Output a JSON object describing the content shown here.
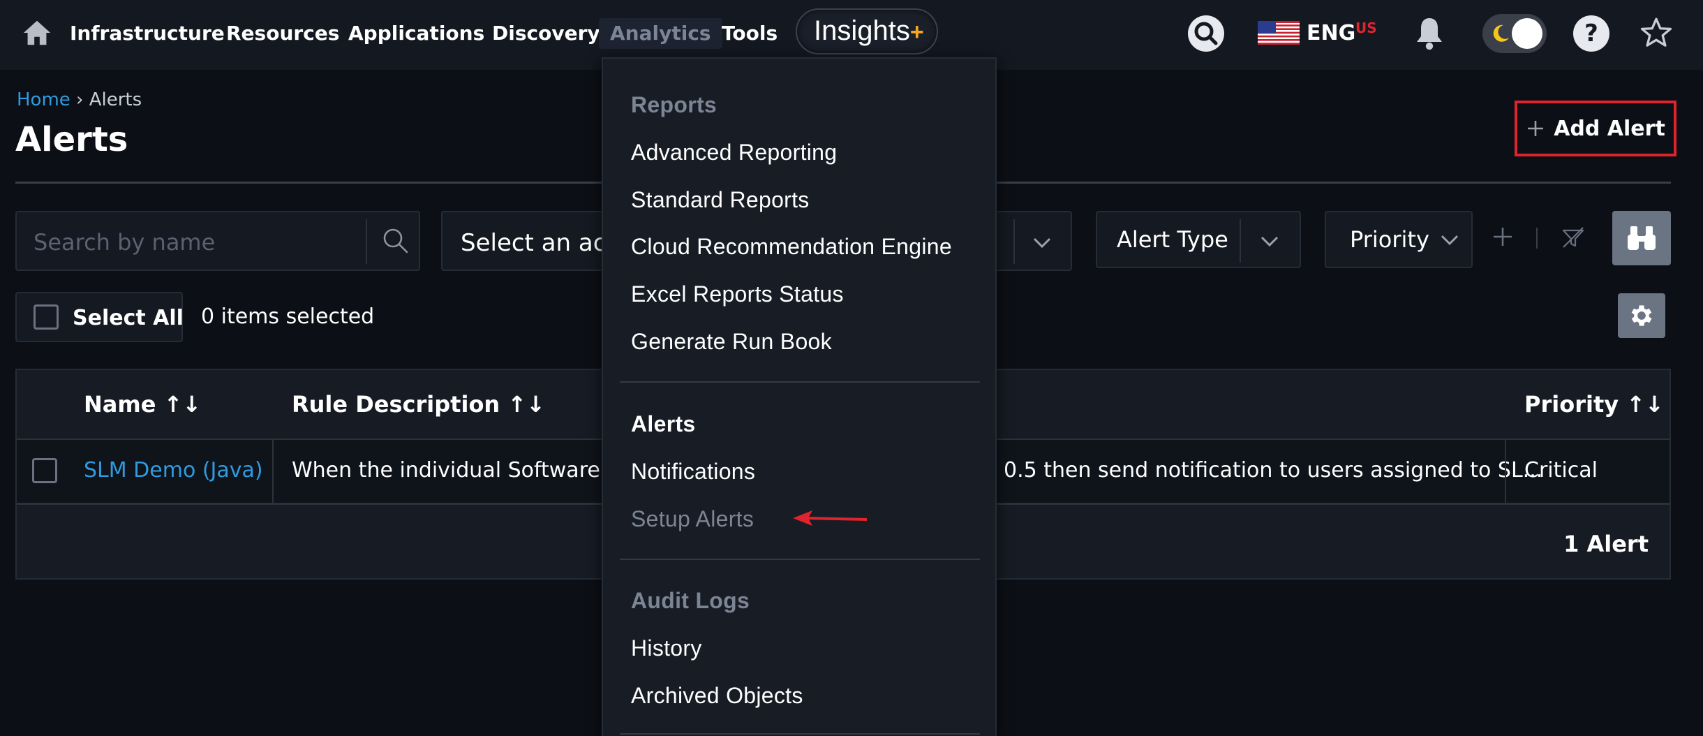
{
  "nav": {
    "items": [
      "Infrastructure",
      "Resources",
      "Applications",
      "Discovery",
      "Analytics",
      "Tools"
    ],
    "insights_label": "Insights",
    "insights_plus": "+",
    "language": "ENG",
    "language_region": "US",
    "help_glyph": "?"
  },
  "breadcrumb": {
    "home": "Home",
    "separator": "›",
    "current": "Alerts"
  },
  "page": {
    "title": "Alerts",
    "add_button": "Add Alert"
  },
  "filters": {
    "search_placeholder": "Search by name",
    "action_select": "Select an acti",
    "alert_type": "Alert Type",
    "priority": "Priority"
  },
  "selection": {
    "select_all": "Select All",
    "items_selected": "0 items selected"
  },
  "table": {
    "headers": {
      "name": "Name ↑↓",
      "rule_description": "Rule Description ↑↓",
      "priority": "Priority ↑↓"
    },
    "rows": [
      {
        "name": "SLM Demo (Java)",
        "rule_start": "When the individual Software Jav",
        "rule_end": "0.5 then send notification to users assigned to SL...",
        "priority": "Critical"
      }
    ],
    "footer": "1 Alert"
  },
  "dropdown": {
    "reports_heading": "Reports",
    "reports": [
      "Advanced Reporting",
      "Standard Reports",
      "Cloud Recommendation Engine",
      "Excel Reports Status",
      "Generate Run Book"
    ],
    "alerts_heading": "Alerts",
    "notifications": "Notifications",
    "setup_alerts": "Setup Alerts",
    "audit_heading": "Audit Logs",
    "audit": [
      "History",
      "Archived Objects"
    ]
  },
  "colors": {
    "background": "#0c0f15",
    "nav_background": "#131821",
    "link": "#2f9be0",
    "accent_red": "#e0242e",
    "insights_plus": "#f5a623",
    "muted_text": "#7c8595"
  }
}
